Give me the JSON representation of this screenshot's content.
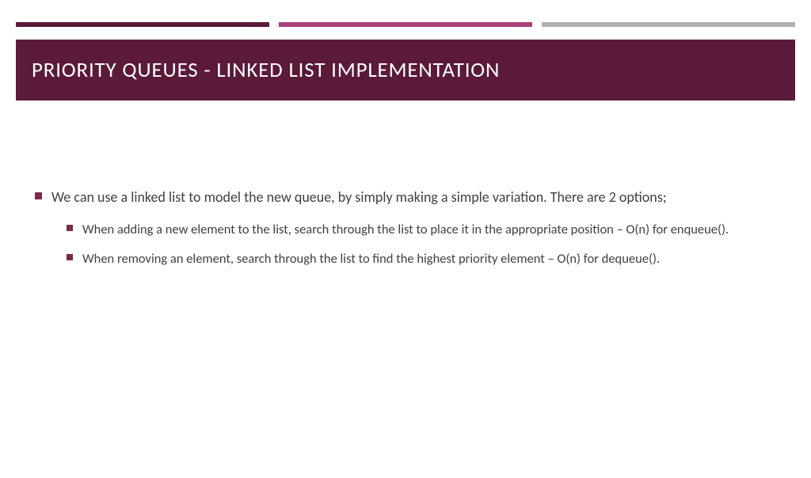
{
  "colors": {
    "accent1": "#5b1a3a",
    "accent2": "#a9427a",
    "accent3": "#b0b0b0"
  },
  "title": "PRIORITY QUEUES - LINKED LIST IMPLEMENTATION",
  "bullets": {
    "main": "We can use a linked list to model the new queue, by simply making a simple variation.  There are 2 options;",
    "subs": [
      "When adding a new element to the list, search through the list to place it in the appropriate position – O(n) for enqueue().",
      "When removing an element, search through the list to find the highest priority element – O(n) for dequeue()."
    ]
  }
}
